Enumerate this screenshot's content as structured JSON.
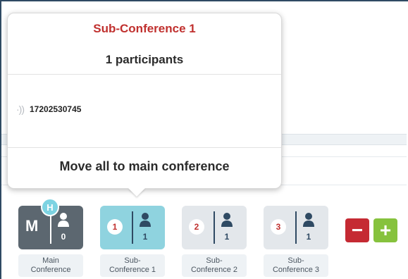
{
  "popover": {
    "title": "Sub-Conference 1",
    "participant_count": "1 participants",
    "participants": [
      {
        "number": "17202530745",
        "icon": "audio-signal-icon"
      }
    ],
    "move_all_label": "Move all to main conference"
  },
  "conferences": [
    {
      "badge": "M",
      "host_badge": "H",
      "count": "0",
      "label_line1": "Main",
      "label_line2": "Conference",
      "state": "dark"
    },
    {
      "badge": "1",
      "count": "1",
      "label_line1": "Sub-",
      "label_line2": "Conference 1",
      "state": "selected"
    },
    {
      "badge": "2",
      "count": "1",
      "label_line1": "Sub-",
      "label_line2": "Conference 2",
      "state": "normal"
    },
    {
      "badge": "3",
      "count": "1",
      "label_line1": "Sub-",
      "label_line2": "Conference 3",
      "state": "normal"
    }
  ],
  "controls": {
    "remove_label": "−",
    "add_label": "+"
  },
  "colors": {
    "title_red": "#c0302e",
    "selected_tile": "#8fd3df",
    "main_tile": "#5c6770",
    "remove_red": "#c52a33",
    "add_green": "#86c23d"
  }
}
